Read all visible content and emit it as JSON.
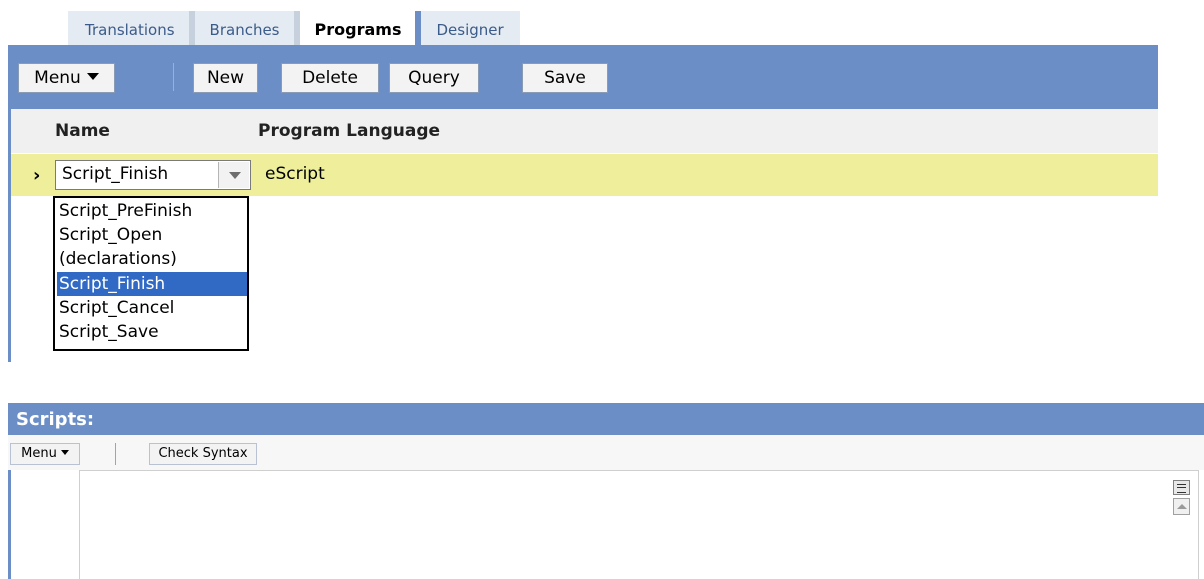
{
  "tabs": [
    {
      "label": "Translations",
      "active": false
    },
    {
      "label": "Branches",
      "active": false
    },
    {
      "label": "Programs",
      "active": true
    },
    {
      "label": "Designer",
      "active": false
    }
  ],
  "toolbar": {
    "menu_label": "Menu",
    "new_label": "New",
    "delete_label": "Delete",
    "query_label": "Query",
    "save_label": "Save"
  },
  "columns": {
    "name": "Name",
    "program_language": "Program Language"
  },
  "row": {
    "name_value": "Script_Finish",
    "program_language": "eScript"
  },
  "dropdown": {
    "options": [
      "Script_PreFinish",
      "Script_Open",
      "(declarations)",
      "Script_Finish",
      "Script_Cancel",
      "Script_Save"
    ],
    "selected": "Script_Finish"
  },
  "scripts": {
    "title": "Scripts:",
    "menu_label": "Menu",
    "check_syntax_label": "Check Syntax"
  },
  "colors": {
    "applet_header": "#6b8ec7",
    "row_highlight": "#eeee9b",
    "selection": "#316ac5"
  }
}
